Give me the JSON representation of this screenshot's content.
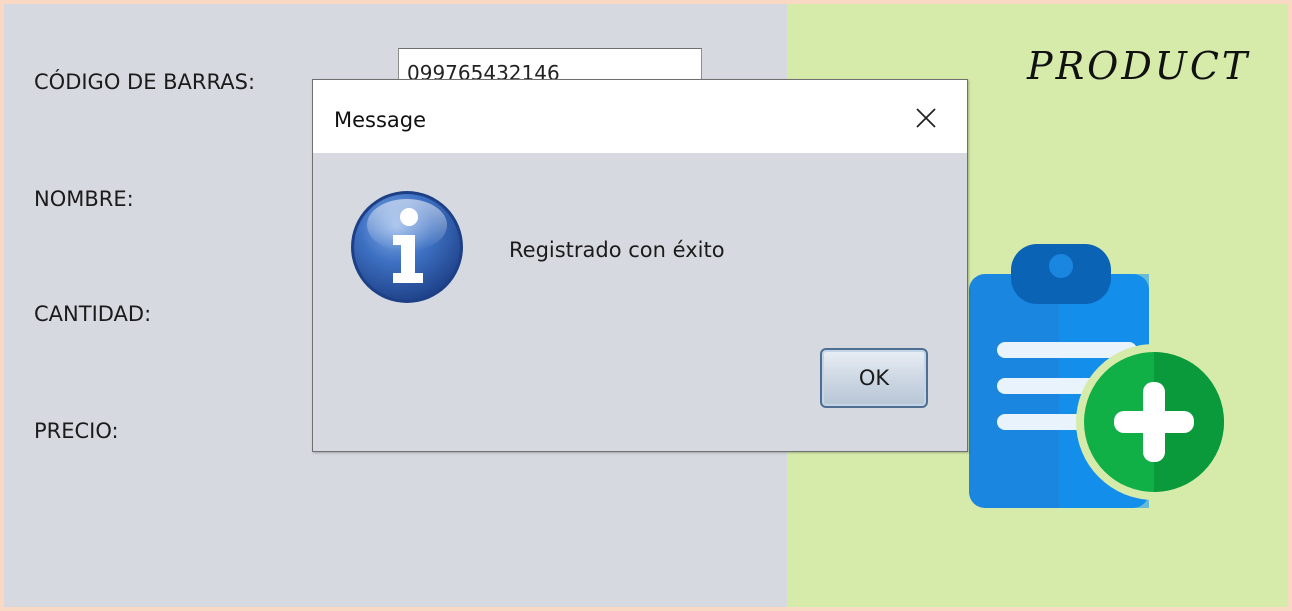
{
  "form": {
    "barcode_label": "CÓDIGO DE BARRAS:",
    "barcode_value": "099765432146",
    "name_label": "NOMBRE:",
    "quantity_label": "CANTIDAD:",
    "price_label": "PRECIO:"
  },
  "panel": {
    "title": "PRODUCT",
    "icon": "clipboard-add-icon"
  },
  "dialog": {
    "title": "Message",
    "close_icon": "close-icon",
    "icon": "information-icon",
    "message": "Registrado con éxito",
    "ok_label": "OK"
  },
  "colors": {
    "left_panel_bg": "#d7d9e0",
    "right_panel_bg": "#d6ebaa",
    "window_border": "#fbdcc8",
    "clipboard_blue": "#1a86e0",
    "plus_green": "#10b047",
    "info_blue": "#2d62b8"
  }
}
